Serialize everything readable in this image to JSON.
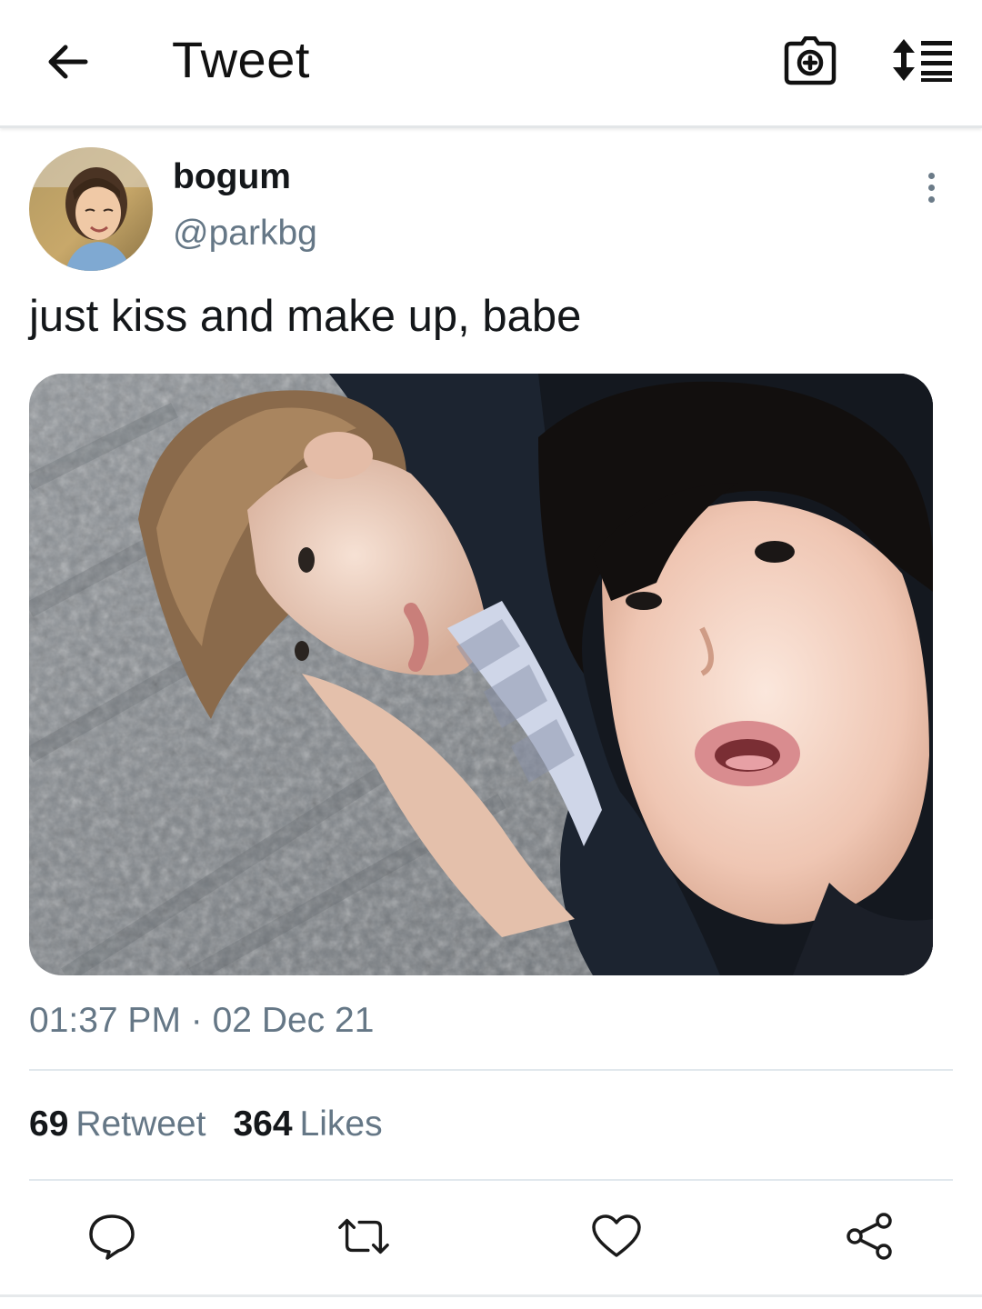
{
  "header": {
    "title": "Tweet",
    "back_icon": "arrow-left-icon",
    "camera_icon": "camera-plus-icon",
    "sort_icon": "sort-list-icon"
  },
  "tweet": {
    "author": {
      "display_name": "bogum",
      "handle": "@parkbg"
    },
    "text": "just kiss and make up, babe",
    "time": "01:37 PM",
    "separator": " · ",
    "date": "02 Dec 21",
    "stats": {
      "retweets_count": "69",
      "retweets_label": "Retweet",
      "likes_count": "364",
      "likes_label": "Likes"
    }
  },
  "actions": {
    "reply_icon": "reply-bubble-icon",
    "retweet_icon": "retweet-icon",
    "like_icon": "heart-icon",
    "share_icon": "share-icon"
  },
  "colors": {
    "text_primary": "#14171a",
    "text_secondary": "#657786",
    "divider": "#e1e8ed",
    "icon": "#1a1a1a"
  }
}
